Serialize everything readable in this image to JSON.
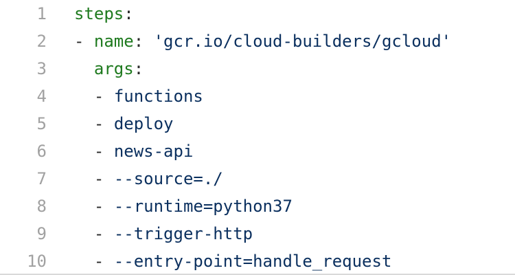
{
  "editor": {
    "lines": [
      {
        "num": "1",
        "parts": [
          {
            "cls": "key",
            "text": "steps"
          },
          {
            "cls": "punct",
            "text": ":"
          }
        ]
      },
      {
        "num": "2",
        "parts": [
          {
            "cls": "punct",
            "text": "- "
          },
          {
            "cls": "key",
            "text": "name"
          },
          {
            "cls": "punct",
            "text": ": "
          },
          {
            "cls": "str",
            "text": "'gcr.io/cloud-builders/gcloud'"
          }
        ]
      },
      {
        "num": "3",
        "parts": [
          {
            "cls": "plain",
            "text": "  "
          },
          {
            "cls": "key",
            "text": "args"
          },
          {
            "cls": "punct",
            "text": ":"
          }
        ]
      },
      {
        "num": "4",
        "parts": [
          {
            "cls": "plain",
            "text": "  "
          },
          {
            "cls": "punct",
            "text": "- "
          },
          {
            "cls": "plain",
            "text": "functions"
          }
        ]
      },
      {
        "num": "5",
        "parts": [
          {
            "cls": "plain",
            "text": "  "
          },
          {
            "cls": "punct",
            "text": "- "
          },
          {
            "cls": "plain",
            "text": "deploy"
          }
        ]
      },
      {
        "num": "6",
        "parts": [
          {
            "cls": "plain",
            "text": "  "
          },
          {
            "cls": "punct",
            "text": "- "
          },
          {
            "cls": "plain",
            "text": "news-api"
          }
        ]
      },
      {
        "num": "7",
        "parts": [
          {
            "cls": "plain",
            "text": "  "
          },
          {
            "cls": "punct",
            "text": "- "
          },
          {
            "cls": "plain",
            "text": "--source=./"
          }
        ]
      },
      {
        "num": "8",
        "parts": [
          {
            "cls": "plain",
            "text": "  "
          },
          {
            "cls": "punct",
            "text": "- "
          },
          {
            "cls": "plain",
            "text": "--runtime=python37"
          }
        ]
      },
      {
        "num": "9",
        "parts": [
          {
            "cls": "plain",
            "text": "  "
          },
          {
            "cls": "punct",
            "text": "- "
          },
          {
            "cls": "plain",
            "text": "--trigger-http"
          }
        ]
      },
      {
        "num": "10",
        "parts": [
          {
            "cls": "plain",
            "text": "  "
          },
          {
            "cls": "punct",
            "text": "- "
          },
          {
            "cls": "plain",
            "text": "--entry-point=handle_request"
          }
        ]
      }
    ]
  },
  "colors": {
    "key": "#1f7a1f",
    "string": "#0a2f5e",
    "line_number": "#a1a1a1"
  }
}
